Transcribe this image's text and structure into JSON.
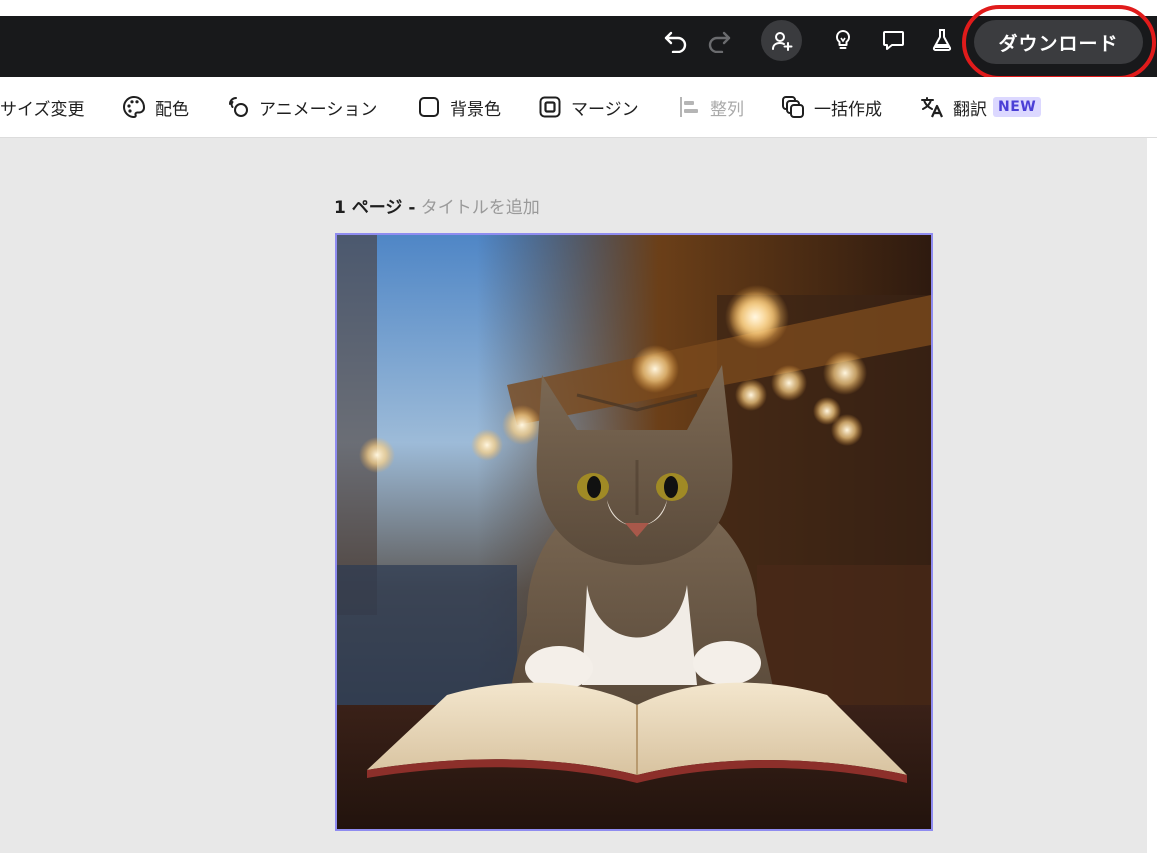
{
  "header": {
    "download_label": "ダウンロード"
  },
  "toolbar": {
    "items": [
      {
        "label": "サイズ変更",
        "icon": "resize-icon"
      },
      {
        "label": "配色",
        "icon": "palette-icon"
      },
      {
        "label": "アニメーション",
        "icon": "animation-icon"
      },
      {
        "label": "背景色",
        "icon": "background-color-icon"
      },
      {
        "label": "マージン",
        "icon": "margin-icon"
      },
      {
        "label": "整列",
        "icon": "align-icon",
        "disabled": true
      },
      {
        "label": "一括作成",
        "icon": "bulk-create-icon"
      },
      {
        "label": "翻訳",
        "icon": "translate-icon",
        "badge": "NEW"
      }
    ]
  },
  "page": {
    "number_label": "1 ページ -",
    "title_placeholder": "タイトルを追加"
  },
  "colors": {
    "header_bg": "#18191b",
    "canvas_bg": "#e8e8e8",
    "selection_border": "#8f8cf0",
    "annotation_red": "#e01b1b"
  }
}
